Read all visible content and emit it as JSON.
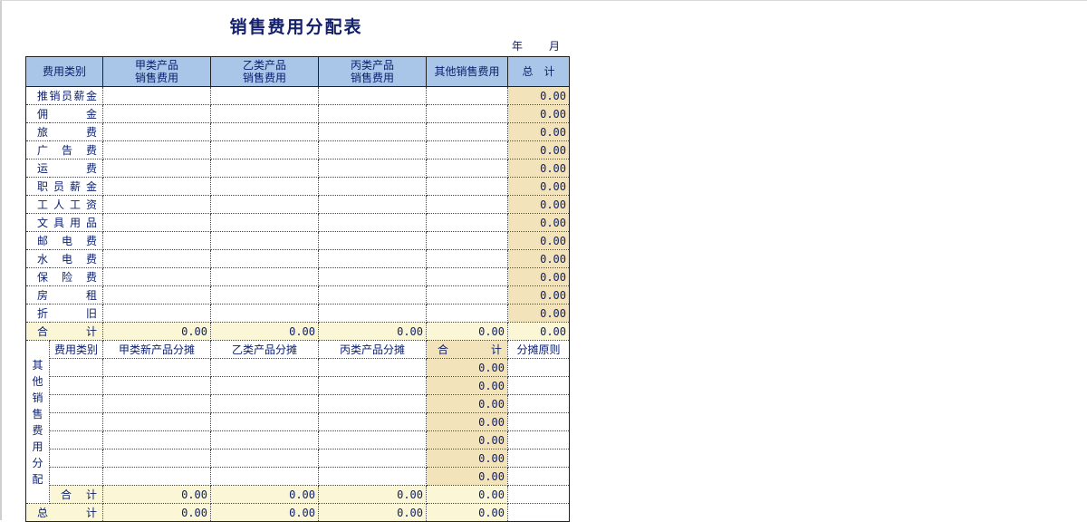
{
  "title": "销售费用分配表",
  "date": {
    "year": "年",
    "month": "月"
  },
  "header": {
    "category": "费用类别",
    "product_a": "甲类产品\n销售费用",
    "product_b": "乙类产品\n销售费用",
    "product_c": "丙类产品\n销售费用",
    "other": "其他销售费用",
    "total": "总　计"
  },
  "expense_rows": [
    {
      "label": "推销员薪金",
      "total": "0.00"
    },
    {
      "label": "佣金",
      "total": "0.00"
    },
    {
      "label": "旅费",
      "total": "0.00"
    },
    {
      "label": "广告费",
      "total": "0.00"
    },
    {
      "label": "运费",
      "total": "0.00"
    },
    {
      "label": "职员薪金",
      "total": "0.00"
    },
    {
      "label": "工人工资",
      "total": "0.00"
    },
    {
      "label": "文具用品",
      "total": "0.00"
    },
    {
      "label": "邮电费",
      "total": "0.00"
    },
    {
      "label": "水电费",
      "total": "0.00"
    },
    {
      "label": "保险费",
      "total": "0.00"
    },
    {
      "label": "房租",
      "total": "0.00"
    },
    {
      "label": "折旧",
      "total": "0.00"
    }
  ],
  "subtotal": {
    "label": "合计",
    "a": "0.00",
    "b": "0.00",
    "c": "0.00",
    "other": "0.00",
    "total": "0.00"
  },
  "allocation": {
    "side_label": "其他销售费用分配",
    "header": {
      "category": "费用类别",
      "a": "甲类新产品分摊",
      "b": "乙类产品分摊",
      "c": "丙类产品分摊",
      "total": "合　计",
      "basis": "分摊原则"
    },
    "row_totals": [
      "0.00",
      "0.00",
      "0.00",
      "0.00",
      "0.00",
      "0.00",
      "0.00"
    ],
    "subtotal": {
      "label": "合计",
      "a": "0.00",
      "b": "0.00",
      "c": "0.00",
      "total": "0.00"
    }
  },
  "grand_total": {
    "label": "总计",
    "a": "0.00",
    "b": "0.00",
    "c": "0.00",
    "total": "0.00"
  }
}
